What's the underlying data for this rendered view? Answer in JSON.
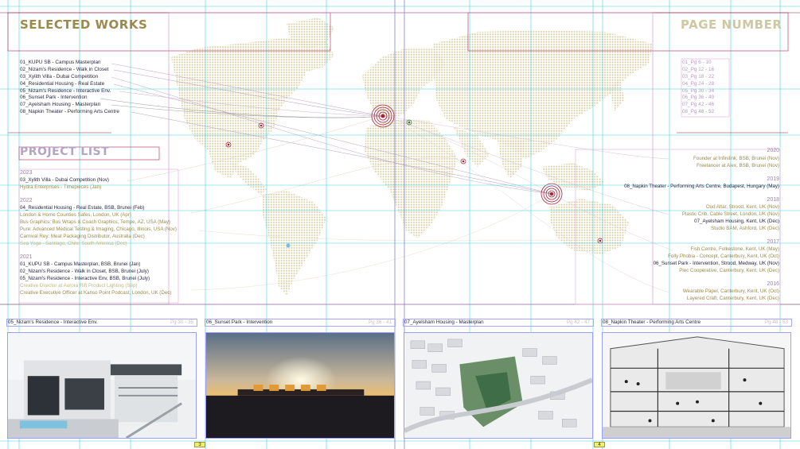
{
  "headings": {
    "selected_works": "SELECTED WORKS",
    "page_number": "PAGE NUMBER",
    "project_list": "PROJECT LIST"
  },
  "selected_works": [
    "01_KUPU SB - Campus Masterplan",
    "02_Nizam's Residence - Walk in Closet",
    "03_Xylith Villa - Dubai Competition",
    "04_Residential Housing - Real Estate",
    "05_Nizam's Residence - Interactive Env.",
    "06_Sunset Park - Intervention",
    "07_Ayelsham Housing - Masterplan",
    "08_Napkin Theater - Performing Arts Centre"
  ],
  "page_numbers": [
    "01_Pg 6 - 10",
    "02_Pg 12 - 16",
    "03_Pg 18 - 22",
    "04_Pg 24 - 28",
    "05_Pg 30 - 34",
    "06_Pg 36 - 40",
    "07_Pg 42 - 46",
    "08_Pg 48 - 52"
  ],
  "left_timeline": {
    "y2023": "2023",
    "e2023_1": "03_Xylith Villa - Dubai Competition (Nov)",
    "e2023_2": "Hydra Enterprises - Timepieces (Jan)",
    "y2022": "2022",
    "e2022_1": "04_Residential Housing - Real Estate, BSB, Brunei (Feb)",
    "e2022_2": "London & Home Counties Safes, London, UK (Apr)",
    "e2022_3": "Bus Graphics: Bus Wraps & Coach Graphics, Tempe, AZ, USA (May)",
    "e2022_4": "Pure: Advanced Medical Testing & Imaging, Chicago, Illinois, USA (Nov)",
    "e2022_5": "Carnival Rey: Meat Packaging Distributor, Australia (Dec)",
    "e2022_6": "Sea Yoga - Santiago, Chile, South America (Dec)",
    "y2021": "2021",
    "e2021_1": "01_KUPU SB - Campus Masterplan, BSB, Brunei (Jan)",
    "e2021_2": "02_Nizam's Residence - Walk in Closet, BSB, Brunei (July)",
    "e2021_3": "05_Nizam's Residence - Interactive Env, BSB, Brunei (July)",
    "e2021_4": "Creative Director at Aurora Rift Product Lighting (Sep)",
    "e2021_5": "Creative Executive Officer at Kanso Point Podcast, London, UK (Dec)"
  },
  "right_timeline": {
    "y2020": "2020",
    "e2020_1": "Founder at Infinilink, BSB, Brunei (Nov)",
    "e2020_2": "Freelancer at Alex, BSB, Brunei (Nov)",
    "y2019": "2019",
    "e2019_1": "08_Napkin Theater - Performing Arts Centre, Budapest, Hungary (May)",
    "y2018": "2018",
    "e2018_1": "Oud Altar, Strood, Kent, UK (Nov)",
    "e2018_2": "Plastic Crib, Cable Street, London, UK (Nov)",
    "e2018_3": "07_Ayelsham Housing, Kent, UK (Dec)",
    "e2018_4": "Studio BAM, Ashford, UK (Dec)",
    "y2017": "2017",
    "e2017_1": "Fish Centre, Folkestone, Kent, UK (May)",
    "e2017_2": "Folly Phobia - Concept, Canterbury, Kent, UK (Oct)",
    "e2017_3": "06_Sunset Park - Intervention, Strood, Medway, UK (Nov)",
    "e2017_4": "Plec Cooperative, Canterbury, Kent, UK (Dec)",
    "y2016": "2016",
    "e2016_1": "Wearable Papel, Canterbury, Kent, UK (Oct)",
    "e2016_2": "Layered Craft, Canterbury, Kent, UK (Dec)"
  },
  "cards": [
    {
      "title": "05_Nizam's Residence - Interactive Env.",
      "pages": "Pg 30 - 35"
    },
    {
      "title": "06_Sunset Park - Intervention",
      "pages": "Pg 36 - 41"
    },
    {
      "title": "07_Ayelsham Housing - Masterplan",
      "pages": "Pg 42 - 47"
    },
    {
      "title": "08_Napkin Theater - Performing Arts Centre",
      "pages": "Pg 48 - 53"
    }
  ],
  "folios": {
    "left": "3",
    "right": "4"
  },
  "colors": {
    "accent_gold": "#9a8a4c",
    "map_dots": "#d9cfa6",
    "marker_red": "#a4243b",
    "guide_cyan": "#3fd0e6",
    "guide_violet": "#b071c4"
  },
  "icons": {
    "location_marker": "target-icon",
    "bullet": "dot-icon"
  }
}
